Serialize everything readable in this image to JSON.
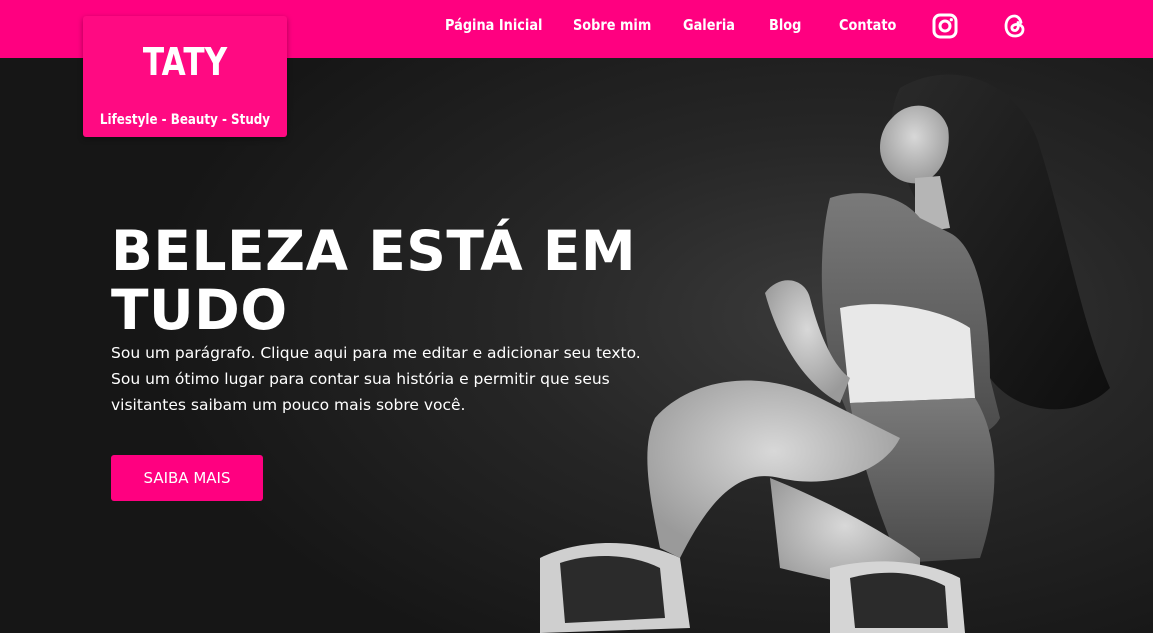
{
  "brand": {
    "title": "TATY",
    "tagline": "Lifestyle - Beauty - Study"
  },
  "nav": {
    "items": [
      "Página Inicial",
      "Sobre mim",
      "Galeria",
      "Blog",
      "Contato"
    ],
    "social": [
      "instagram-icon",
      "threads-icon"
    ]
  },
  "hero": {
    "headline_line1": "BELEZA ESTÁ EM",
    "headline_line2": "TUDO",
    "paragraph_line1": "Sou um parágrafo. Clique aqui para me editar e adicionar seu texto.",
    "paragraph_line2": "Sou um ótimo lugar para contar sua história e permitir que seus",
    "paragraph_line3": "visitantes saibam um pouco mais sobre você.",
    "cta_label": "SAIBA MAIS"
  },
  "colors": {
    "accent": "#ff0080",
    "hero_background": "#1c1c1c",
    "text": "#ffffff"
  }
}
